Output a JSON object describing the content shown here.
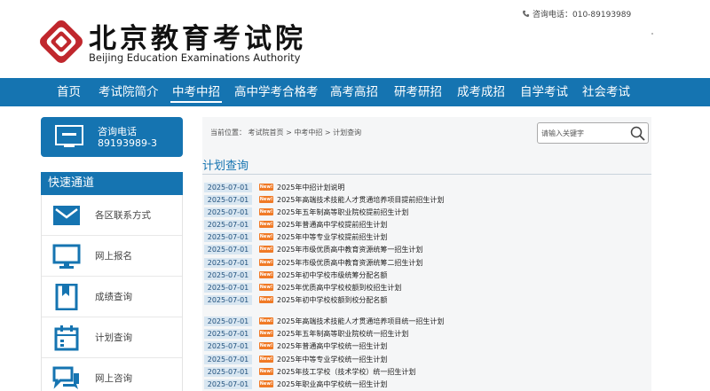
{
  "header": {
    "logo_cn": "北京教育考试院",
    "logo_en": "Beijing Education Examinations Authority",
    "hotline": "咨询电话：010-89193989",
    "brand_color": "#c0272d"
  },
  "nav": {
    "items": [
      {
        "label": "首页"
      },
      {
        "label": "考试院简介"
      },
      {
        "label": "中考中招",
        "active": true
      },
      {
        "label": "高中学考合格考"
      },
      {
        "label": "高考高招"
      },
      {
        "label": "研考研招"
      },
      {
        "label": "成考成招"
      },
      {
        "label": "自学考试"
      },
      {
        "label": "社会考试"
      }
    ],
    "color": "#1574b1"
  },
  "sidebar": {
    "hotline_card": {
      "title": "咨询电话",
      "number": "89193989-3",
      "icon": "monitor-card-icon"
    },
    "quick_title": "快速通道",
    "quick_items": [
      {
        "label": "各区联系方式",
        "icon": "mail-icon"
      },
      {
        "label": "网上报名",
        "icon": "monitor-icon"
      },
      {
        "label": "成绩查询",
        "icon": "bookmark-icon"
      },
      {
        "label": "计划查询",
        "icon": "calendar-icon"
      },
      {
        "label": "网上咨询",
        "icon": "chat-icon"
      }
    ]
  },
  "main": {
    "breadcrumb": "当前位置： 考试院首页 > 中考中招 > 计划查询",
    "search_placeholder": "请输入关键字",
    "section_title": "计划查询",
    "badge": "New!",
    "news": [
      {
        "date": "2025-07-01",
        "title": "2025年中招计划说明"
      },
      {
        "date": "2025-07-01",
        "title": "2025年高端技术技能人才贯通培养项目提前招生计划"
      },
      {
        "date": "2025-07-01",
        "title": "2025年五年制高等职业院校提前招生计划"
      },
      {
        "date": "2025-07-01",
        "title": "2025年普通高中学校提前招生计划"
      },
      {
        "date": "2025-07-01",
        "title": "2025年中等专业学校提前招生计划"
      },
      {
        "date": "2025-07-01",
        "title": "2025年市级优质高中教育资源统筹一招生计划"
      },
      {
        "date": "2025-07-01",
        "title": "2025年市级优质高中教育资源统筹二招生计划"
      },
      {
        "date": "2025-07-01",
        "title": "2025年初中学校市级统筹分配名额"
      },
      {
        "date": "2025-07-01",
        "title": "2025年优质高中学校校额到校招生计划"
      },
      {
        "date": "2025-07-01",
        "title": "2025年初中学校校额到校分配名额"
      },
      {
        "date": "2025-07-01",
        "title": "2025年高端技术技能人才贯通培养项目统一招生计划"
      },
      {
        "date": "2025-07-01",
        "title": "2025年五年制高等职业院校统一招生计划"
      },
      {
        "date": "2025-07-01",
        "title": "2025年普通高中学校统一招生计划"
      },
      {
        "date": "2025-07-01",
        "title": "2025年中等专业学校统一招生计划"
      },
      {
        "date": "2025-07-01",
        "title": "2025年技工学校（技术学校）统一招生计划"
      },
      {
        "date": "2025-07-01",
        "title": "2025年职业高中学校统一招生计划"
      }
    ]
  }
}
